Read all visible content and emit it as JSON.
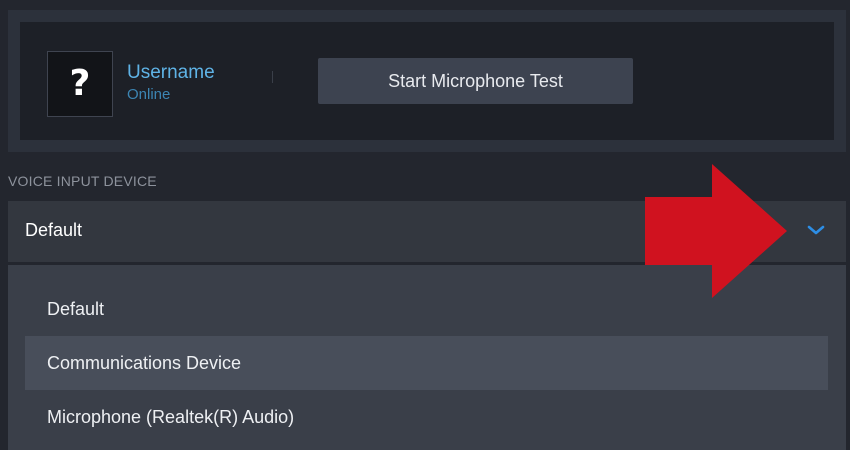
{
  "user": {
    "avatar_glyph": "?",
    "name": "Username",
    "status": "Online"
  },
  "mic_test": {
    "label": "Start Microphone Test"
  },
  "voice_input": {
    "section_label": "VOICE INPUT DEVICE",
    "selected": "Default",
    "options": [
      {
        "label": "Default",
        "highlighted": false
      },
      {
        "label": "Communications Device",
        "highlighted": true
      },
      {
        "label": "Microphone (Realtek(R) Audio)",
        "highlighted": false
      }
    ]
  },
  "icons": {
    "dropdown": "chevron-down-icon",
    "annotation": "red-arrow-right"
  },
  "colors": {
    "background": "#23262e",
    "accent_blue": "#5fb3e6",
    "status_blue": "#3c85b3",
    "annotation_red": "#d0121f"
  }
}
